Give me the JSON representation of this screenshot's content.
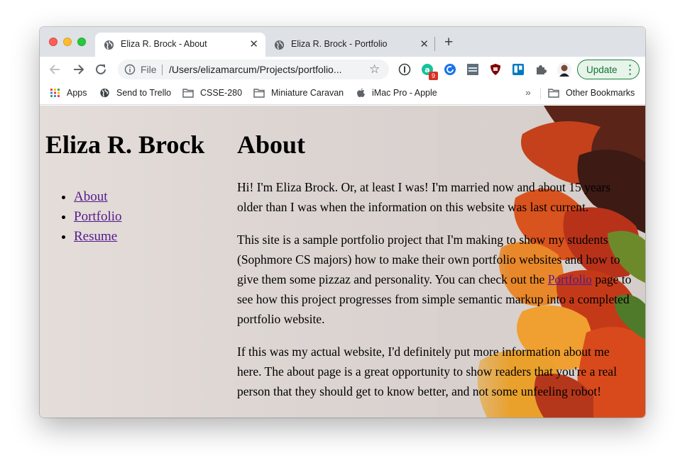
{
  "browser": {
    "tabs": [
      {
        "title": "Eliza R. Brock - About",
        "active": true
      },
      {
        "title": "Eliza R. Brock - Portfolio",
        "active": false
      }
    ],
    "new_tab_label": "+",
    "tab_close_label": "✕",
    "address": {
      "scheme_label": "File",
      "url": "/Users/elizamarcum/Projects/portfolio..."
    },
    "update_label": "Update",
    "extension_badge": "9"
  },
  "bookmarks": {
    "items": [
      "Apps",
      "Send to Trello",
      "CSSE-280",
      "Miniature Caravan",
      "iMac Pro - Apple"
    ],
    "overflow": "»",
    "other": "Other Bookmarks"
  },
  "page": {
    "site_title": "Eliza R. Brock",
    "nav": [
      "About",
      "Portfolio",
      "Resume"
    ],
    "heading": "About",
    "p1": "Hi! I'm Eliza Brock. Or, at least I was! I'm married now and about 15 years older than I was when the information on this website was last current.",
    "p2_before": "This site is a sample portfolio project that I'm making to show my students (Sophmore CS majors) how to make their own portfolio websites and how to give them some pizzaz and personality. You can check out the ",
    "p2_link": "Portfolio",
    "p2_after": " page to see how this project progresses from simple semantic markup into a completed portfolio website.",
    "p3": "If this was my actual website, I'd definitely put more information about me here. The about page is a great opportunity to show readers that you're a real person that they should get to know better, and not some unfeeling robot!"
  },
  "colors": {
    "tabstrip": "#dee1e6",
    "link_visited": "#551a8b",
    "update_green": "#137333"
  }
}
